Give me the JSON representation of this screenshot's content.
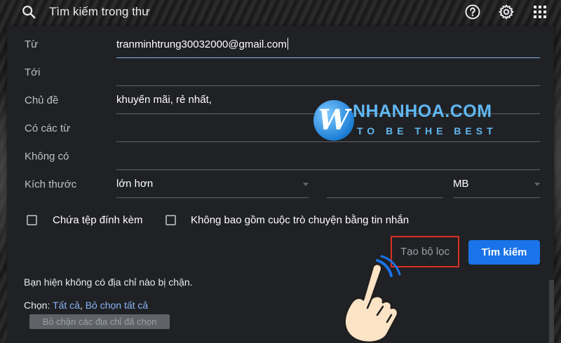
{
  "topbar": {
    "search_placeholder": "Tìm kiếm trong thư",
    "icons": [
      "search-icon",
      "help-icon",
      "gear-icon",
      "apps-icon"
    ]
  },
  "filter_form": {
    "from": {
      "label": "Từ",
      "value": "tranminhtrung30032000@gmail.com"
    },
    "to": {
      "label": "Tới",
      "value": ""
    },
    "subject": {
      "label": "Chủ đề",
      "value": "khuyến mãi, rẻ nhất,"
    },
    "has_words": {
      "label": "Có các từ",
      "value": ""
    },
    "doesnt_have": {
      "label": "Không có",
      "value": ""
    },
    "size": {
      "label": "Kích thước",
      "operator": "lớn hơn",
      "value": "",
      "unit": "MB"
    },
    "has_attachment": {
      "label": "Chứa tệp đính kèm",
      "checked": false
    },
    "exclude_chats": {
      "label": "Không bao gồm cuộc trò chuyện bằng tin nhắn",
      "checked": false
    },
    "create_filter_label": "Tạo bộ lọc",
    "search_label": "Tìm kiếm"
  },
  "blocked": {
    "message": "Bạn hiện không có địa chỉ nào bị chặn.",
    "select_prefix": "Chọn:",
    "select_all": "Tất cả",
    "deselect_all": "Bỏ chọn tất cả",
    "unblock_button": "Bỏ chặn các địa chỉ đã chọn"
  },
  "watermark": {
    "logo_letter": "W",
    "title": "NHANHOA.COM",
    "tagline": "TO BE THE BEST"
  },
  "colors": {
    "accent_blue": "#1a73e8",
    "highlight_red": "#d93025",
    "link_blue": "#8ab4f8",
    "panel_bg": "#202124"
  }
}
